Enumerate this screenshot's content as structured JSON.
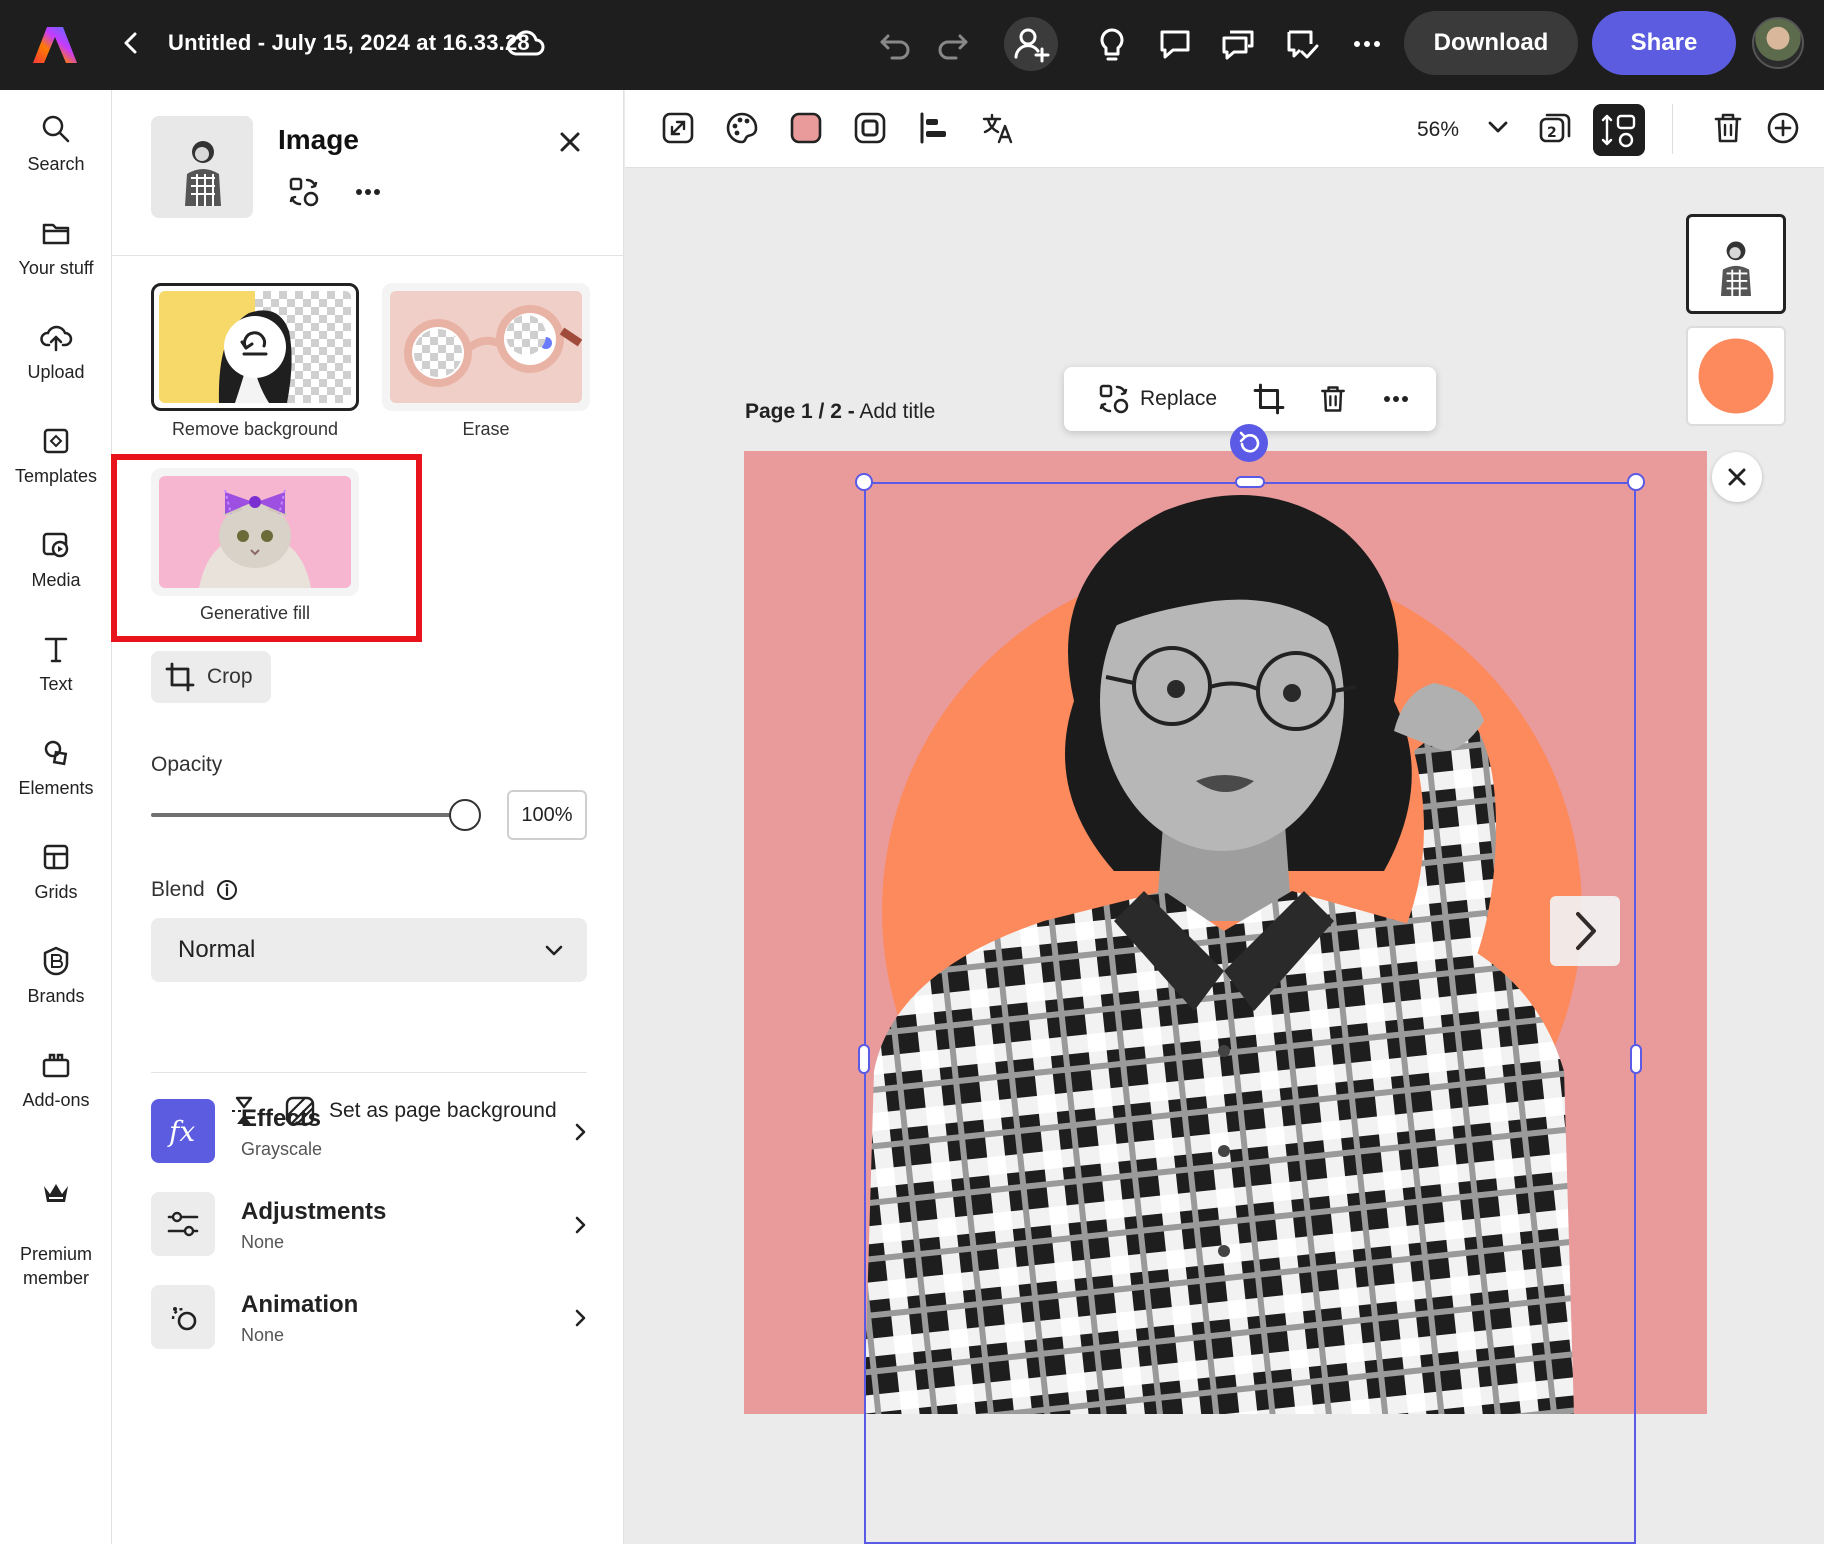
{
  "topbar": {
    "doc_title": "Untitled - July 15, 2024 at 16.33.28",
    "download_label": "Download",
    "share_label": "Share",
    "icons": [
      "adobe-express-logo",
      "back-icon",
      "cloud-icon",
      "undo-icon",
      "redo-icon",
      "add-collaborator-icon",
      "lightbulb-icon",
      "comment-icon",
      "comments-icon",
      "review-icon",
      "more-icon"
    ]
  },
  "rail": {
    "items": [
      {
        "label": "Search",
        "icon": "search-icon"
      },
      {
        "label": "Your stuff",
        "icon": "folder-icon"
      },
      {
        "label": "Upload",
        "icon": "upload-icon"
      },
      {
        "label": "Templates",
        "icon": "templates-icon"
      },
      {
        "label": "Media",
        "icon": "media-icon"
      },
      {
        "label": "Text",
        "icon": "text-icon"
      },
      {
        "label": "Elements",
        "icon": "elements-icon"
      },
      {
        "label": "Grids",
        "icon": "grids-icon"
      },
      {
        "label": "Brands",
        "icon": "brands-icon"
      },
      {
        "label": "Add-ons",
        "icon": "addons-icon"
      },
      {
        "label": "Premium\nmember",
        "icon": "premium-crown-icon"
      }
    ]
  },
  "panel": {
    "title": "Image",
    "tools": {
      "remove_background": "Remove background",
      "erase": "Erase",
      "generative_fill": "Generative fill"
    },
    "crop_label": "Crop",
    "opacity_label": "Opacity",
    "opacity_value": "100%",
    "opacity_fraction": 1.0,
    "blend_label": "Blend",
    "blend_value": "Normal",
    "set_bg_label": "Set as page background",
    "effects": {
      "title": "Effects",
      "value": "Grayscale"
    },
    "adjustments": {
      "title": "Adjustments",
      "value": "None"
    },
    "animation": {
      "title": "Animation",
      "value": "None"
    }
  },
  "canvas": {
    "zoom": "56%",
    "page_label_bold": "Page 1 / 2 -",
    "page_label_title": "Add title",
    "ctx_replace": "Replace",
    "artboard_bg": "#e99a9a",
    "accent_circle": "#fd8a5c",
    "selection_color": "#5a5ae6",
    "highlight_color": "#e8131b",
    "share_color": "#5c5ce0"
  }
}
